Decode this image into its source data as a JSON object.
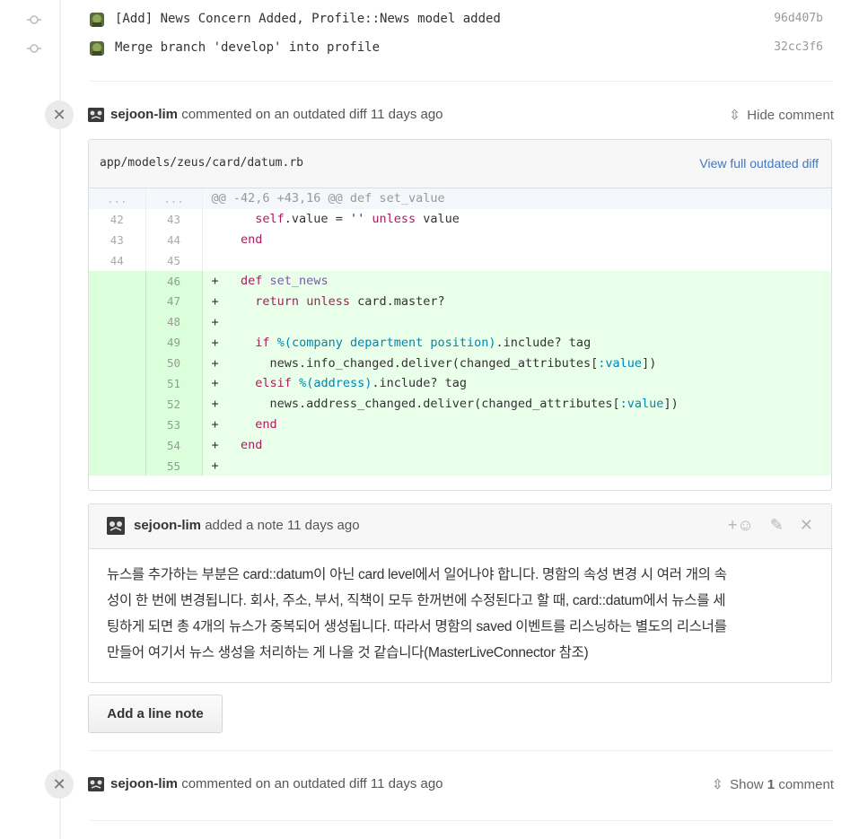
{
  "commits": [
    {
      "message": "[Add] News Concern Added, Profile::News model added",
      "sha": "96d407b"
    },
    {
      "message": "Merge branch 'develop' into profile",
      "sha": "32cc3f6"
    }
  ],
  "thread1": {
    "username": "sejoon-lim",
    "action_text": "commented on an outdated diff 11 days ago",
    "toggle_label": "Hide comment",
    "file_path": "app/models/zeus/card/datum.rb",
    "view_full_label": "View full outdated diff",
    "hunk": {
      "old": "...",
      "new": "...",
      "text": "@@ -42,6 +43,16 @@ def set_value"
    },
    "context_lines": [
      {
        "old": "42",
        "new": "43"
      },
      {
        "old": "43",
        "new": "44"
      },
      {
        "old": "44",
        "new": "45"
      }
    ],
    "added_lines": [
      "46",
      "47",
      "48",
      "49",
      "50",
      "51",
      "52",
      "53",
      "54",
      "55"
    ],
    "note": {
      "username": "sejoon-lim",
      "meta": "added a note 11 days ago",
      "body_lines": [
        "뉴스를 추가하는 부분은 card::datum이 아닌 card level에서 일어나야 합니다. 명함의 속성 변경 시 여러 개의 속",
        "성이 한 번에 변경됩니다. 회사, 주소, 부서, 직책이 모두 한꺼번에 수정된다고 할 때, card::datum에서 뉴스를 세",
        "팅하게 되면 총 4개의 뉴스가 중복되어 생성됩니다. 따라서 명함의 saved 이벤트를 리스닝하는 별도의 리스너를",
        "만들어 여기서 뉴스 생성을 처리하는 게 나을 것 같습니다(MasterLiveConnector 참조)"
      ]
    },
    "add_note_label": "Add a line note"
  },
  "thread2": {
    "username": "sejoon-lim",
    "action_text": "commented on an outdated diff 11 days ago",
    "toggle_prefix": "Show",
    "toggle_count": "1",
    "toggle_suffix": "comment"
  },
  "colors": {
    "link": "#4078c0",
    "addition_bg": "#eaffea",
    "keyword": "#a71d5d"
  }
}
